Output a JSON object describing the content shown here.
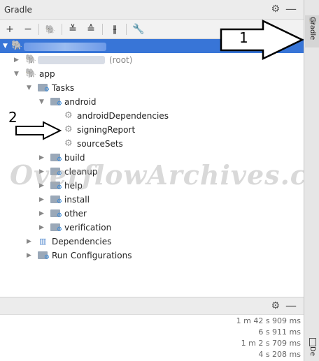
{
  "panel": {
    "title": "Gradle",
    "gear_icon": "gear-icon",
    "minimize_icon": "minimize-icon"
  },
  "toolbar": {
    "buttons": [
      {
        "icon": "plus-icon",
        "glyph": "+"
      },
      {
        "icon": "minus-icon",
        "glyph": "−"
      },
      {
        "icon": "elephant-icon",
        "glyph": "🐘"
      },
      {
        "icon": "expand-all-icon",
        "glyph": "⇳"
      },
      {
        "icon": "collapse-all-icon",
        "glyph": "⇕"
      },
      {
        "icon": "toggle-offline-icon",
        "glyph": "⇹"
      },
      {
        "icon": "wrench-icon",
        "glyph": "🔧"
      }
    ]
  },
  "tree": {
    "root_label": "",
    "root_path_suffix": "(root)",
    "app": "app",
    "tasks": "Tasks",
    "android": "android",
    "android_tasks": [
      "androidDependencies",
      "signingReport",
      "sourceSets"
    ],
    "task_groups": [
      "build",
      "cleanup",
      "help",
      "install",
      "other",
      "verification"
    ],
    "dependencies": "Dependencies",
    "run_configurations": "Run Configurations"
  },
  "annotations": {
    "callout_1": "1",
    "callout_2": "2"
  },
  "watermark": "OverflowArchives.com",
  "bottom_panel": {
    "timings": [
      "1 m 42 s 909 ms",
      "6 s 911 ms",
      "1 m 2 s 709 ms",
      "4 s 208 ms"
    ]
  },
  "right_sidebar": {
    "gradle_tab": "Gradle",
    "device_tab": "De"
  },
  "colors": {
    "selection": "#3875d7",
    "folder_cog": "#3b8ad8"
  }
}
